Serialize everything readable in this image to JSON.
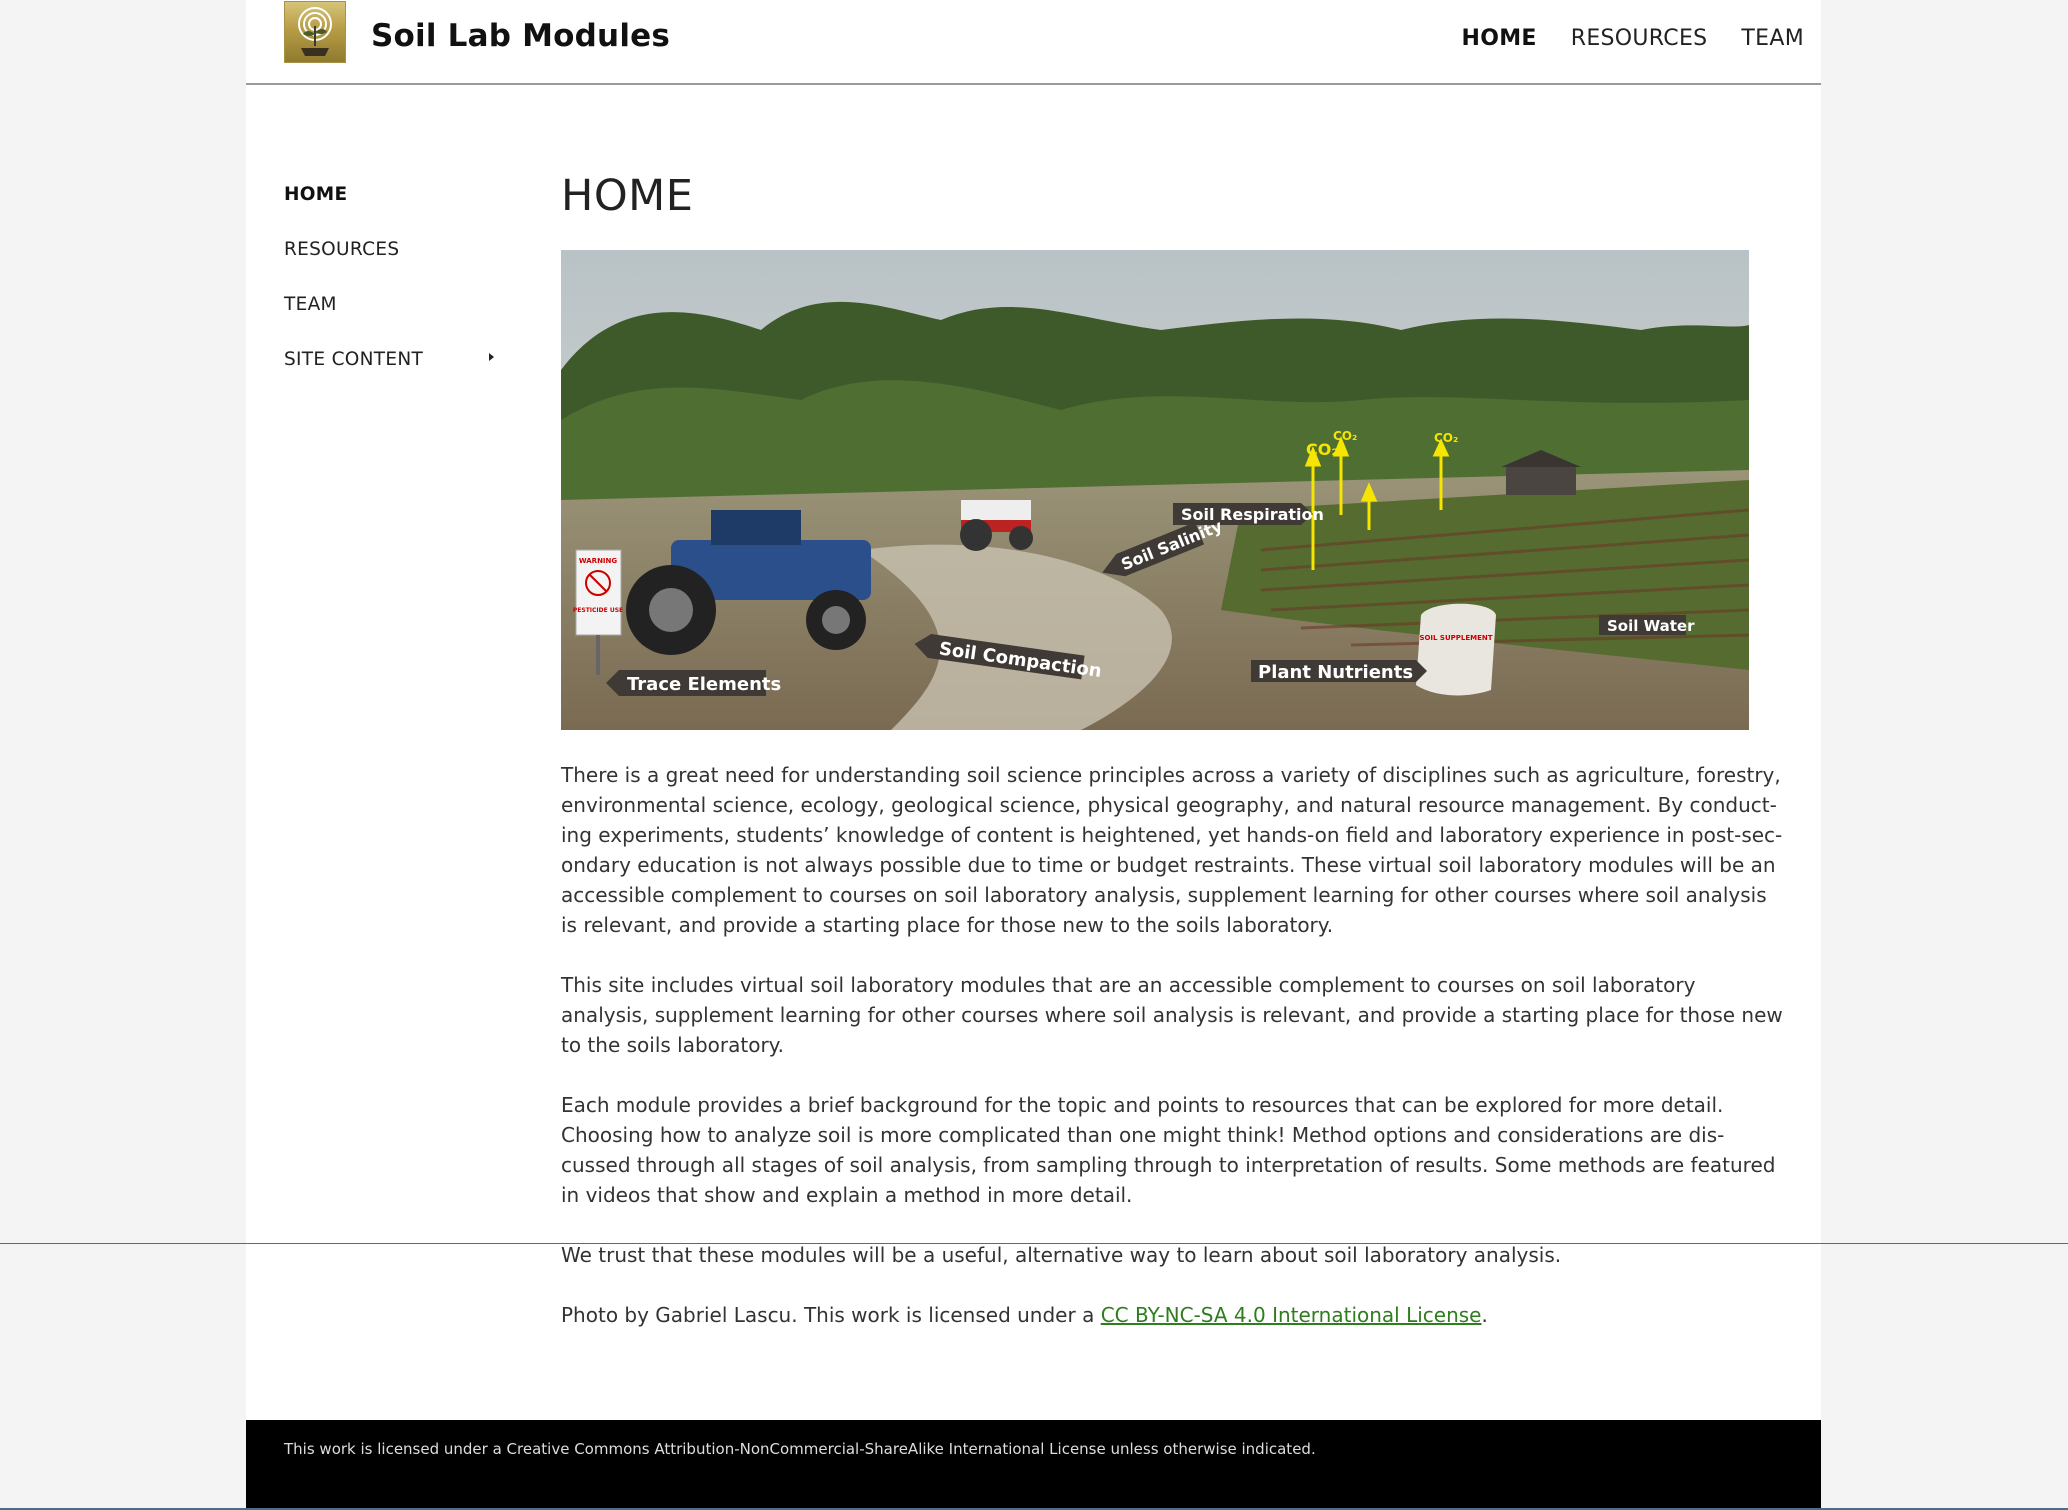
{
  "header": {
    "site_title": "Soil Lab Modules",
    "nav": [
      {
        "label": "HOME",
        "active": true
      },
      {
        "label": "RESOURCES",
        "active": false
      },
      {
        "label": "TEAM",
        "active": false
      }
    ]
  },
  "sidebar": {
    "items": [
      {
        "label": "HOME",
        "active": true
      },
      {
        "label": "RESOURCES",
        "active": false
      },
      {
        "label": "TEAM",
        "active": false
      },
      {
        "label": "SITE CONTENT",
        "active": false,
        "has_submenu": true
      }
    ]
  },
  "main": {
    "title": "HOME",
    "hero_labels": {
      "co2": "CO₂",
      "soil_respiration": "Soil Respiration",
      "soil_salinity": "Soil Salinity",
      "soil_water": "Soil Water",
      "plant_nutrients": "Plant Nutrients",
      "soil_compaction": "Soil Compaction",
      "trace_elements": "Trace Elements",
      "sign_warning": "WARNING",
      "sign_pesticide": "PESTICIDE USE",
      "bag_label": "SOIL SUPPLEMENT"
    },
    "paragraphs": [
      "There is a great need for understanding soil science principles across a variety of disciplines such as agriculture, forestry, environmental science, ecology, geological science, physical geography, and natural resource management. By conduct-ing experiments, students’ knowledge of content is heightened, yet hands-on field and laboratory experience in post-sec-ondary education is not always possible due to time or budget restraints. These virtual soil laboratory modules will be an accessible complement to courses on soil laboratory analysis, supplement learning for other courses where soil analysis is relevant, and provide a starting place for those new to the soils laboratory.",
      "This site includes virtual soil laboratory modules that are an accessible complement to courses on soil laboratory analysis, supplement learning for other courses where soil analysis is relevant, and provide a starting place for those new to the soils laboratory.",
      "Each module provides a brief background for the topic and points to resources that can be explored for more detail. Choosing how to analyze soil is more complicated than one might think! Method options and considerations are dis-cussed through all stages of soil analysis, from sampling through to interpretation of results. Some methods are featured in videos that show and explain a method in more detail.",
      "We trust that these modules will be a useful, alternative way to learn about soil laboratory analysis."
    ],
    "credit": {
      "prefix": "Photo by Gabriel Lascu. This work is licensed under a ",
      "link_text": "CC BY-NC-SA 4.0 International License",
      "suffix": "."
    }
  },
  "footer": {
    "text": "This work is licensed under a Creative Commons Attribution-NonCommercial-ShareAlike International License unless otherwise indicated."
  },
  "colors": {
    "link": "#2e7d1e",
    "footer_bg": "#000000",
    "page_bg": "#f4f4f4"
  }
}
